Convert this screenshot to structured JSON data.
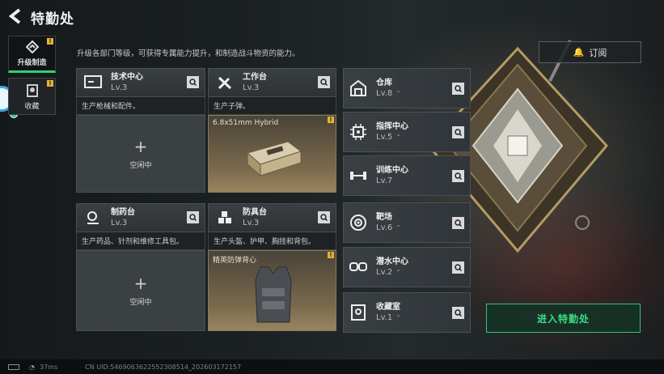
{
  "header": {
    "title": "特勤处",
    "subtitle": "升级各部门等级，可获得专属能力提升，和制造战斗物资的能力。",
    "subscribe_label": "订阅"
  },
  "tabs": [
    {
      "label": "升级制造",
      "badge": "!"
    },
    {
      "label": "收藏",
      "badge": "!"
    }
  ],
  "workbenches": [
    {
      "name": "技术中心",
      "level": "Lv.3",
      "desc": "生产枪械和配件。",
      "state": "空闲中"
    },
    {
      "name": "工作台",
      "level": "Lv.3",
      "desc": "生产子弹。",
      "product": "6.8x51mm Hybrid",
      "badge": "!"
    },
    {
      "name": "制药台",
      "level": "Lv.3",
      "desc": "生产药品、针剂和维修工具包。",
      "state": "空闲中"
    },
    {
      "name": "防具台",
      "level": "Lv.3",
      "desc": "生产头盔、护甲、胸挂和背包。",
      "product": "精英防弹背心",
      "badge": "!"
    }
  ],
  "rooms": [
    {
      "name": "仓库",
      "level": "Lv.8",
      "icon": "warehouse-icon"
    },
    {
      "name": "指挥中心",
      "level": "Lv.5",
      "icon": "chip-icon"
    },
    {
      "name": "训练中心",
      "level": "Lv.7",
      "icon": "dumbbell-icon"
    },
    {
      "name": "靶场",
      "level": "Lv.6",
      "icon": "target-icon"
    },
    {
      "name": "潜水中心",
      "level": "Lv.2",
      "icon": "goggles-icon"
    },
    {
      "name": "收藏室",
      "level": "Lv.1",
      "icon": "trophy-icon"
    }
  ],
  "enter_label": "进入特勤处",
  "footer": {
    "ping": "37ms",
    "uid": "CN UID:5469063622552308514_202603172157"
  },
  "colors": {
    "accent_green": "#2fcf7b",
    "badge_yellow": "#e2b33a",
    "panel": "#3a3f43"
  }
}
